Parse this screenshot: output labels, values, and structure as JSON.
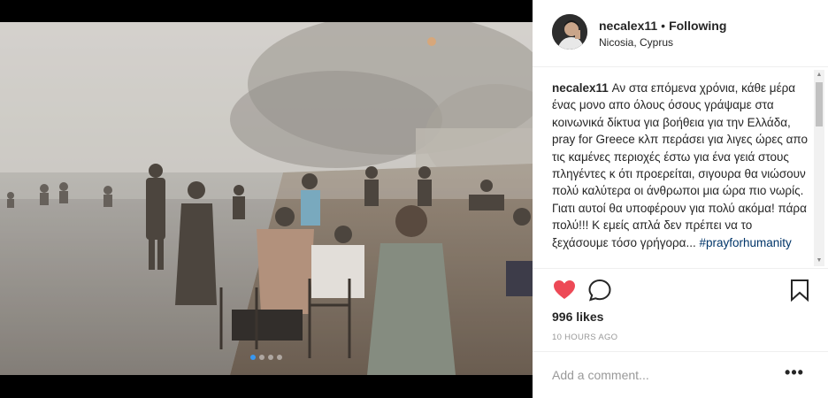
{
  "post": {
    "username": "necalex11",
    "separator": "•",
    "follow_status": "Following",
    "location": "Nicosia, Cyprus"
  },
  "caption": {
    "username": "necalex11",
    "text": "Αν στα επόμενα χρόνια, κάθε μέρα ένας μονο απο όλους όσους γράψαμε στα κοινωνικά δίκτυα για βοήθεια για την Ελλάδα, pray for Greece κλπ περάσει για λιγες ώρες απο τις καμένες περιοχές έστω για ένα γειά στους πληγέντες κ ότι προερείται, σιγουρα θα νιώσουν πολύ καλύτερα οι άνθρωποι μια ώρα πιο νωρίς. Γιατι αυτοί θα υποφέρουν για πολύ ακόμα! πάρα πολύ!!! Κ εμείς απλά δεν πρέπει να το ξεχάσουμε τόσο γρήγορα...",
    "hashtag": "#prayforhumanity"
  },
  "carousel": {
    "count": 4,
    "active_index": 0,
    "active_color": "#3897f0"
  },
  "actions": {
    "like_icon": "heart-filled",
    "like_color": "#ed4956",
    "comment_icon": "speech-bubble",
    "save_icon": "bookmark"
  },
  "likes_text": "996 likes",
  "timestamp": "10 HOURS AGO",
  "comment": {
    "placeholder": "Add a comment...",
    "more_label": "•••"
  }
}
